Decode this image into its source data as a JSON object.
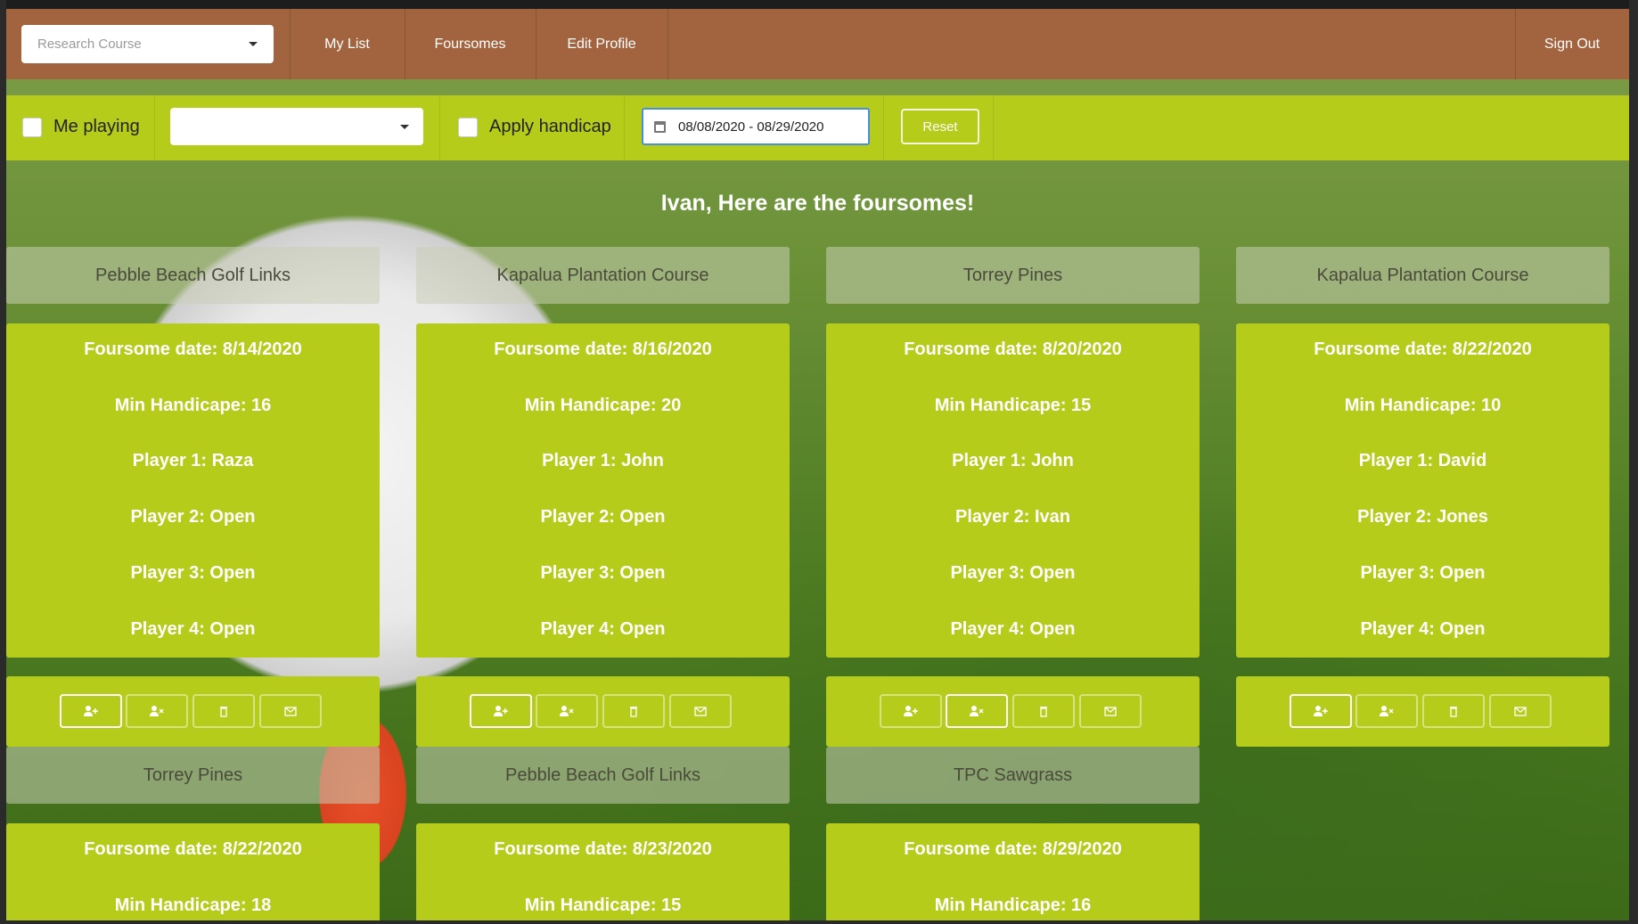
{
  "nav": {
    "course_placeholder": "Research Course",
    "my_list": "My List",
    "foursomes": "Foursomes",
    "edit_profile": "Edit Profile",
    "sign_out": "Sign Out"
  },
  "filters": {
    "me_playing": "Me playing",
    "player_select_value": "",
    "apply_handicap": "Apply handicap",
    "date_range": "08/08/2020 - 08/29/2020",
    "reset": "Reset"
  },
  "greeting": "Ivan, Here are the foursomes!",
  "colors": {
    "nav_bg": "#a2633f",
    "panel_bg": "#b5cc1b"
  },
  "cards": [
    {
      "course": "Pebble Beach Golf Links",
      "date": "Foursome date: 8/14/2020",
      "min_handicap": "Min Handicape: 16",
      "player1": "Player 1: Raza",
      "player2": "Player 2: Open",
      "player3": "Player 3: Open",
      "player4": "Player 4: Open",
      "active_action": "join"
    },
    {
      "course": "Kapalua Plantation Course",
      "date": "Foursome date: 8/16/2020",
      "min_handicap": "Min Handicape: 20",
      "player1": "Player 1: John",
      "player2": "Player 2: Open",
      "player3": "Player 3: Open",
      "player4": "Player 4: Open",
      "active_action": "join"
    },
    {
      "course": "Torrey Pines",
      "date": "Foursome date: 8/20/2020",
      "min_handicap": "Min Handicape: 15",
      "player1": "Player 1: John",
      "player2": "Player 2: Ivan",
      "player3": "Player 3: Open",
      "player4": "Player 4: Open",
      "active_action": "leave"
    },
    {
      "course": "Kapalua Plantation Course",
      "date": "Foursome date: 8/22/2020",
      "min_handicap": "Min Handicape: 10",
      "player1": "Player 1: David",
      "player2": "Player 2: Jones",
      "player3": "Player 3: Open",
      "player4": "Player 4: Open",
      "active_action": "join"
    },
    {
      "course": "Torrey Pines",
      "date": "Foursome date: 8/22/2020",
      "min_handicap": "Min Handicape: 18"
    },
    {
      "course": "Pebble Beach Golf Links",
      "date": "Foursome date: 8/23/2020",
      "min_handicap": "Min Handicape: 15"
    },
    {
      "course": "TPC Sawgrass",
      "date": "Foursome date: 8/29/2020",
      "min_handicap": "Min Handicape: 16"
    }
  ],
  "action_icons": [
    "user-plus-icon",
    "user-times-icon",
    "trash-icon",
    "envelope-icon"
  ]
}
